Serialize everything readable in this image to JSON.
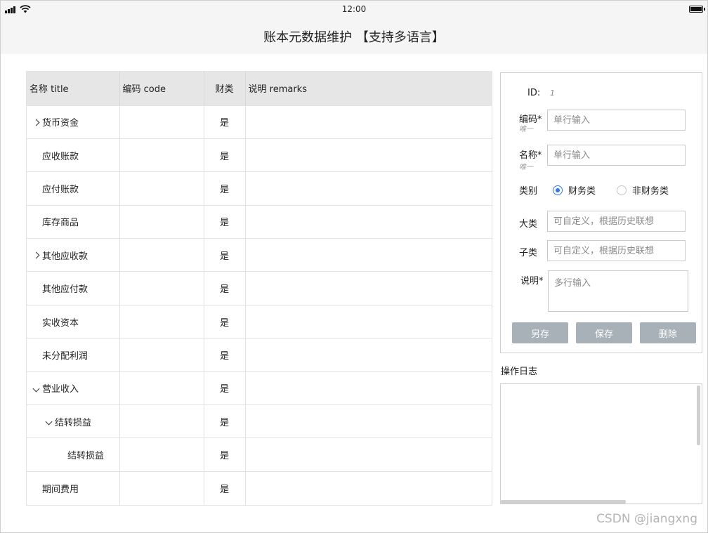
{
  "status_bar": {
    "time": "12:00"
  },
  "header": {
    "title": "账本元数据维护 【支持多语言】"
  },
  "table": {
    "columns": [
      "名称  title",
      "编码 code",
      "财类",
      "说明  remarks"
    ],
    "rows": [
      {
        "name": "货币资金",
        "indent": 0,
        "toggle": "collapsed",
        "code": "",
        "fin": "是",
        "remarks": ""
      },
      {
        "name": "应收账款",
        "indent": 0,
        "toggle": "none",
        "code": "",
        "fin": "是",
        "remarks": ""
      },
      {
        "name": "应付账款",
        "indent": 0,
        "toggle": "none",
        "code": "",
        "fin": "是",
        "remarks": ""
      },
      {
        "name": "库存商品",
        "indent": 0,
        "toggle": "none",
        "code": "",
        "fin": "是",
        "remarks": ""
      },
      {
        "name": "其他应收款",
        "indent": 0,
        "toggle": "collapsed",
        "code": "",
        "fin": "是",
        "remarks": ""
      },
      {
        "name": "其他应付款",
        "indent": 0,
        "toggle": "none",
        "code": "",
        "fin": "是",
        "remarks": ""
      },
      {
        "name": "实收资本",
        "indent": 0,
        "toggle": "none",
        "code": "",
        "fin": "是",
        "remarks": ""
      },
      {
        "name": "未分配利润",
        "indent": 0,
        "toggle": "none",
        "code": "",
        "fin": "是",
        "remarks": ""
      },
      {
        "name": "营业收入",
        "indent": 0,
        "toggle": "expanded",
        "code": "",
        "fin": "是",
        "remarks": ""
      },
      {
        "name": "结转损益",
        "indent": 1,
        "toggle": "expanded",
        "code": "",
        "fin": "是",
        "remarks": ""
      },
      {
        "name": "结转损益",
        "indent": 2,
        "toggle": "none",
        "code": "",
        "fin": "是",
        "remarks": ""
      },
      {
        "name": "期间费用",
        "indent": 0,
        "toggle": "none",
        "code": "",
        "fin": "是",
        "remarks": ""
      }
    ]
  },
  "form": {
    "id_label": "ID:",
    "id_value": "1",
    "code_label": "编码*",
    "code_hint": "唯一",
    "code_placeholder": "单行输入",
    "name_label": "名称*",
    "name_hint": "唯一",
    "name_placeholder": "单行输入",
    "category_label": "类别",
    "category_options": [
      {
        "label": "财务类",
        "selected": true
      },
      {
        "label": "非财务类",
        "selected": false
      }
    ],
    "major_label": "大类",
    "major_placeholder": "可自定义，根据历史联想",
    "sub_label": "子类",
    "sub_placeholder": "可自定义，根据历史联想",
    "remark_label": "说明*",
    "remark_placeholder": "多行输入",
    "buttons": {
      "save_as": "另存",
      "save": "保存",
      "delete": "删除"
    },
    "accent_color": "#2f7bdc",
    "button_color": "#a8b0b8"
  },
  "log": {
    "title": "操作日志"
  },
  "watermark": "CSDN @jiangxng"
}
